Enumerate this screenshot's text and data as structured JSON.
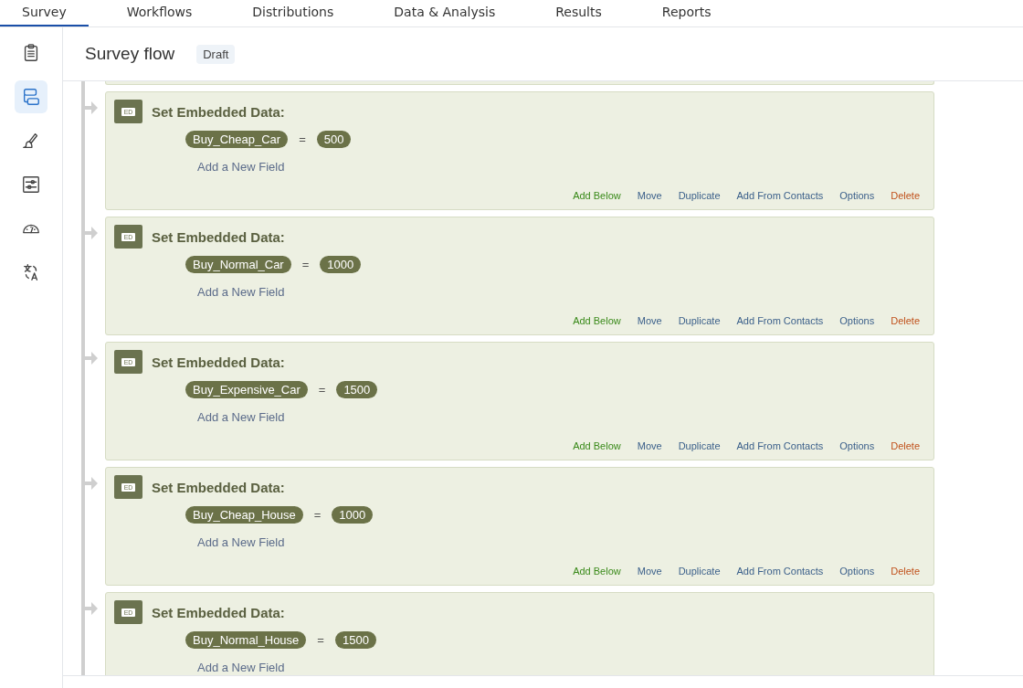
{
  "tabs": [
    {
      "label": "Survey",
      "selected": true
    },
    {
      "label": "Workflows",
      "selected": false
    },
    {
      "label": "Distributions",
      "selected": false
    },
    {
      "label": "Data & Analysis",
      "selected": false
    },
    {
      "label": "Results",
      "selected": false
    },
    {
      "label": "Reports",
      "selected": false
    }
  ],
  "sidebar": {
    "items": [
      {
        "kind": "clipboard",
        "selected": false
      },
      {
        "kind": "flow",
        "selected": true
      },
      {
        "kind": "brush",
        "selected": false
      },
      {
        "kind": "sliders",
        "selected": false
      },
      {
        "kind": "gauge",
        "selected": false
      },
      {
        "kind": "translate",
        "selected": false
      }
    ]
  },
  "header": {
    "title": "Survey flow",
    "status": "Draft"
  },
  "blocks": [
    {
      "badge": "ED",
      "title": "Set Embedded Data:",
      "field": "Buy_Cheap_Car",
      "operator": "=",
      "value": "500",
      "add_field": "Add a New Field",
      "actions": [
        {
          "label": "Add Below",
          "kind": "add"
        },
        {
          "label": "Move",
          "kind": "link"
        },
        {
          "label": "Duplicate",
          "kind": "link"
        },
        {
          "label": "Add From Contacts",
          "kind": "link"
        },
        {
          "label": "Options",
          "kind": "link"
        },
        {
          "label": "Delete",
          "kind": "delete"
        }
      ]
    },
    {
      "badge": "ED",
      "title": "Set Embedded Data:",
      "field": "Buy_Normal_Car",
      "operator": "=",
      "value": "1000",
      "add_field": "Add a New Field",
      "actions": [
        {
          "label": "Add Below",
          "kind": "add"
        },
        {
          "label": "Move",
          "kind": "link"
        },
        {
          "label": "Duplicate",
          "kind": "link"
        },
        {
          "label": "Add From Contacts",
          "kind": "link"
        },
        {
          "label": "Options",
          "kind": "link"
        },
        {
          "label": "Delete",
          "kind": "delete"
        }
      ]
    },
    {
      "badge": "ED",
      "title": "Set Embedded Data:",
      "field": "Buy_Expensive_Car",
      "operator": "=",
      "value": "1500",
      "add_field": "Add a New Field",
      "actions": [
        {
          "label": "Add Below",
          "kind": "add"
        },
        {
          "label": "Move",
          "kind": "link"
        },
        {
          "label": "Duplicate",
          "kind": "link"
        },
        {
          "label": "Add From Contacts",
          "kind": "link"
        },
        {
          "label": "Options",
          "kind": "link"
        },
        {
          "label": "Delete",
          "kind": "delete"
        }
      ]
    },
    {
      "badge": "ED",
      "title": "Set Embedded Data:",
      "field": "Buy_Cheap_House",
      "operator": "=",
      "value": "1000",
      "add_field": "Add a New Field",
      "actions": [
        {
          "label": "Add Below",
          "kind": "add"
        },
        {
          "label": "Move",
          "kind": "link"
        },
        {
          "label": "Duplicate",
          "kind": "link"
        },
        {
          "label": "Add From Contacts",
          "kind": "link"
        },
        {
          "label": "Options",
          "kind": "link"
        },
        {
          "label": "Delete",
          "kind": "delete"
        }
      ]
    },
    {
      "badge": "ED",
      "title": "Set Embedded Data:",
      "field": "Buy_Normal_House",
      "operator": "=",
      "value": "1500",
      "add_field": "Add a New Field"
    }
  ]
}
